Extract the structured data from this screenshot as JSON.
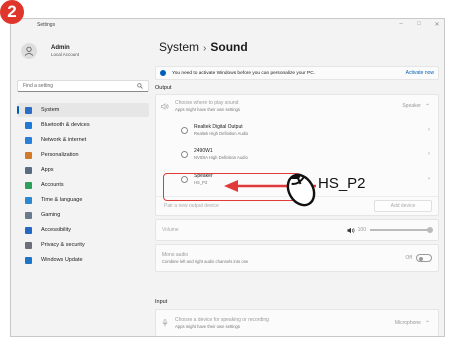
{
  "step": "2",
  "window": {
    "title": "Settings",
    "minimize": "–",
    "maximize": "□",
    "close": "✕"
  },
  "profile": {
    "name": "Admin",
    "sub": "Local Account"
  },
  "search": {
    "placeholder": "Find a setting"
  },
  "nav": [
    {
      "label": "System",
      "color": "#2b6cc4"
    },
    {
      "label": "Bluetooth & devices",
      "color": "#1f7ad6"
    },
    {
      "label": "Network & internet",
      "color": "#2a7fd8"
    },
    {
      "label": "Personalization",
      "color": "#d07a2a"
    },
    {
      "label": "Apps",
      "color": "#5a6c80"
    },
    {
      "label": "Accounts",
      "color": "#2f9e5a"
    },
    {
      "label": "Time & language",
      "color": "#2a87d0"
    },
    {
      "label": "Gaming",
      "color": "#6a7a8a"
    },
    {
      "label": "Accessibility",
      "color": "#2467c4"
    },
    {
      "label": "Privacy & security",
      "color": "#6b6f78"
    },
    {
      "label": "Windows Update",
      "color": "#1d75c8"
    }
  ],
  "breadcrumb": {
    "parent": "System",
    "separator": "›",
    "current": "Sound"
  },
  "activation": {
    "message": "You need to activate Windows before you can personalize your PC.",
    "link": "Activate now"
  },
  "output": {
    "heading": "Output",
    "choose_title": "Choose where to play sound",
    "choose_sub": "Apps might have their own settings",
    "choose_value": "Speaker",
    "devices": [
      {
        "name": "Realtek Digital Output",
        "sub": "Realtek High Definition Audio"
      },
      {
        "name": "2490W1",
        "sub": "NVIDIA High Definition Audio"
      },
      {
        "name": "Speaker",
        "sub": "HS_P2"
      }
    ],
    "pair_label": "Pair a new output device",
    "add_label": "Add device",
    "volume_label": "Volume",
    "volume_value": "100",
    "mono_title": "Mono audio",
    "mono_sub": "Combine left and right audio channels into one",
    "mono_state": "Off"
  },
  "input": {
    "heading": "Input",
    "choose_title": "Choose a device for speaking or recording",
    "choose_sub": "Apps might have their own settings",
    "choose_value": "Microphone"
  },
  "annotation": {
    "label": "HS_P2",
    "color": "#e03a3a"
  }
}
